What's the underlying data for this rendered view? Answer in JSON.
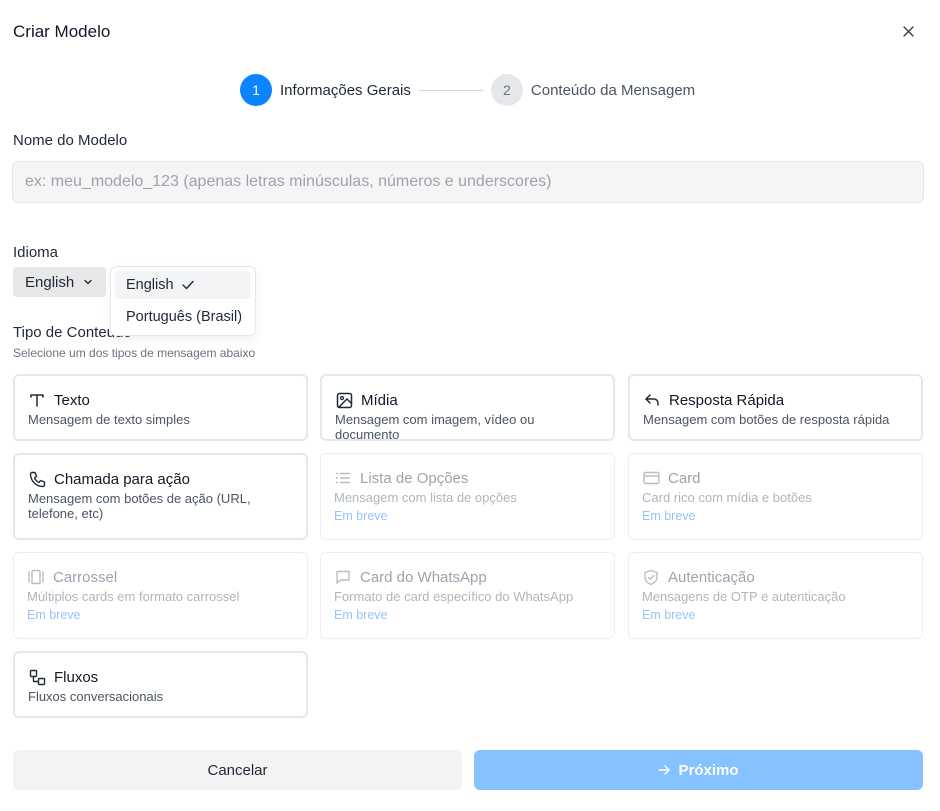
{
  "modal": {
    "title": "Criar Modelo"
  },
  "stepper": {
    "steps": [
      {
        "number": "1",
        "label": "Informações Gerais",
        "state": "active"
      },
      {
        "number": "2",
        "label": "Conteúdo da Mensagem",
        "state": "inactive"
      }
    ]
  },
  "name_field": {
    "label": "Nome do Modelo",
    "value": "",
    "placeholder": "ex: meu_modelo_123 (apenas letras minúsculas, números e underscores)"
  },
  "language": {
    "label": "Idioma",
    "selected": "English",
    "options": [
      {
        "label": "English",
        "selected": true
      },
      {
        "label": "Português (Brasil)",
        "selected": false
      }
    ]
  },
  "content_type": {
    "label": "Tipo de Conteúdo",
    "sublabel": "Selecione um dos tipos de mensagem abaixo",
    "coming_soon_label": "Em breve",
    "cards": [
      {
        "title": "Texto",
        "description": "Mensagem de texto simples",
        "icon": "text-icon",
        "enabled": true
      },
      {
        "title": "Mídia",
        "description": "Mensagem com imagem, vídeo ou documento",
        "icon": "image-icon",
        "enabled": true
      },
      {
        "title": "Resposta Rápida",
        "description": "Mensagem com botões de resposta rápida",
        "icon": "reply-icon",
        "enabled": true
      },
      {
        "title": "Chamada para ação",
        "description": "Mensagem com botões de ação (URL, telefone, etc)",
        "icon": "phone-icon",
        "enabled": true
      },
      {
        "title": "Lista de Opções",
        "description": "Mensagem com lista de opções",
        "icon": "list-icon",
        "enabled": false
      },
      {
        "title": "Card",
        "description": "Card rico com mídia e botões",
        "icon": "credit-card-icon",
        "enabled": false
      },
      {
        "title": "Carrossel",
        "description": "Múltiplos cards em formato carrossel",
        "icon": "carousel-icon",
        "enabled": false
      },
      {
        "title": "Card do WhatsApp",
        "description": "Formato de card específico do WhatsApp",
        "icon": "message-square-icon",
        "enabled": false
      },
      {
        "title": "Autenticação",
        "description": "Mensagens de OTP e autenticação",
        "icon": "shield-check-icon",
        "enabled": false
      },
      {
        "title": "Fluxos",
        "description": "Fluxos conversacionais",
        "icon": "workflow-icon",
        "enabled": true
      }
    ]
  },
  "footer": {
    "cancel_label": "Cancelar",
    "next_label": "Próximo"
  },
  "colors": {
    "primary": "#0a84ff",
    "primary_disabled": "#85c2ff",
    "coming_soon": "#93c5fd"
  }
}
